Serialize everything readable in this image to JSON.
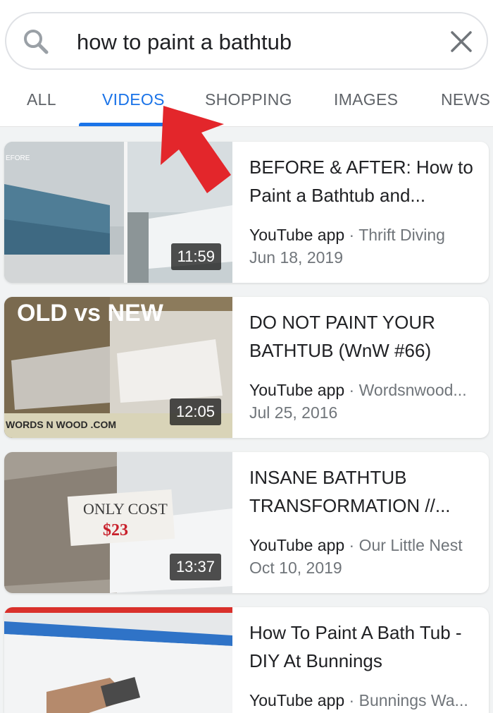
{
  "search": {
    "query": "how to paint a bathtub"
  },
  "tabs": [
    {
      "label": "ALL",
      "active": false
    },
    {
      "label": "VIDEOS",
      "active": true
    },
    {
      "label": "SHOPPING",
      "active": false
    },
    {
      "label": "IMAGES",
      "active": false
    },
    {
      "label": "NEWS",
      "active": false
    }
  ],
  "results": [
    {
      "title": "BEFORE & AFTER: How to Paint a Bathtub and...",
      "source": "YouTube app",
      "separator": "·",
      "channel": "Thrift Diving",
      "date": "Jun 18, 2019",
      "duration": "11:59",
      "thumb_text": "EFORE"
    },
    {
      "title": "DO NOT PAINT YOUR BATHTUB (WnW #66)",
      "source": "YouTube app",
      "separator": "·",
      "channel": "Wordsnwood...",
      "date": "Jul 25, 2016",
      "duration": "12:05",
      "thumb_text": "OLD vs NEW",
      "thumb_footer": "WORDS N WOOD .COM"
    },
    {
      "title": "INSANE BATHTUB TRANSFORMATION //...",
      "source": "YouTube app",
      "separator": "·",
      "channel": "Our Little Nest",
      "date": "Oct 10, 2019",
      "duration": "13:37",
      "thumb_text": "ONLY COST",
      "thumb_price": "$23"
    },
    {
      "title": "How To Paint A Bath Tub - DIY At Bunnings",
      "source": "YouTube app",
      "separator": "·",
      "channel": "Bunnings Wa..."
    }
  ],
  "colors": {
    "accent": "#1a73e8",
    "arrow": "#e3262b",
    "background": "#f1f3f4"
  }
}
